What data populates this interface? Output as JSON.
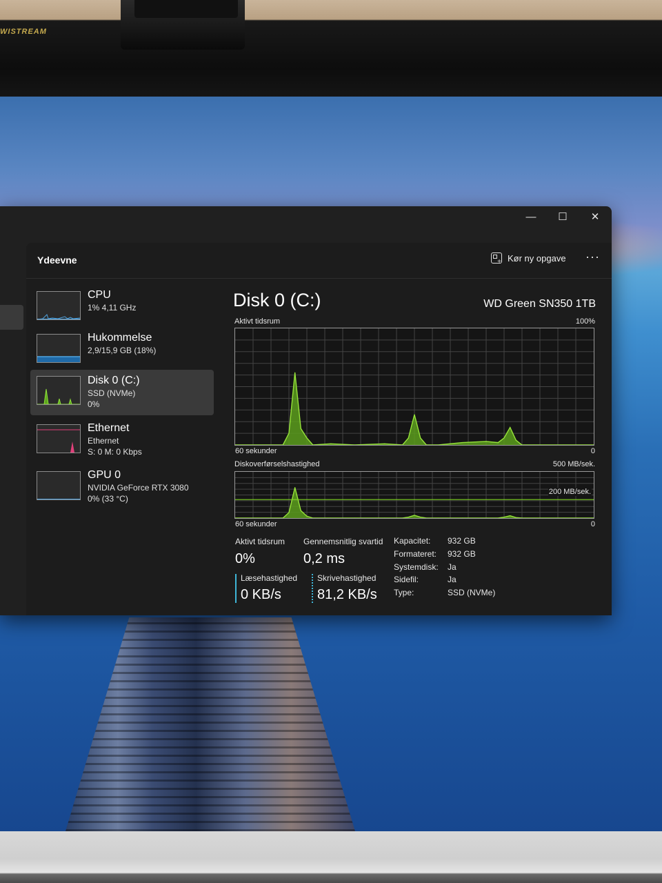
{
  "monitor": {
    "brand": "WISTREAM"
  },
  "window": {
    "controls": {
      "minimize": "—",
      "maximize": "☐",
      "close": "✕"
    },
    "page_title": "Ydeevne",
    "run_task_label": "Kør ny opgave",
    "more_label": "···"
  },
  "sidebar": {
    "items": [
      {
        "name": "CPU",
        "line1": "1% 4,11 GHz",
        "line2": "",
        "line3": "",
        "color": "#4fa3e0"
      },
      {
        "name": "Hukommelse",
        "line1": "2,9/15,9 GB (18%)",
        "line2": "",
        "line3": "",
        "color": "#4fa3e0"
      },
      {
        "name": "Disk 0 (C:)",
        "line1": "SSD (NVMe)",
        "line2": "0%",
        "line3": "",
        "color": "#7fd62a"
      },
      {
        "name": "Ethernet",
        "line1": "Ethernet",
        "line2": "S: 0 M: 0 Kbps",
        "line3": "",
        "color": "#e0407a"
      },
      {
        "name": "GPU 0",
        "line1": "NVIDIA GeForce RTX 3080",
        "line2": "0% (33 °C)",
        "line3": "",
        "color": "#4fa3e0"
      }
    ]
  },
  "detail": {
    "title": "Disk 0 (C:)",
    "model": "WD Green SN350 1TB",
    "graph1": {
      "label": "Aktivt tidsrum",
      "max": "100%",
      "time_label": "60 sekunder",
      "min": "0"
    },
    "graph2": {
      "label": "Diskoverførselshastighed",
      "max": "500 MB/sek.",
      "ref_label": "200 MB/sek.",
      "time_label": "60 sekunder",
      "min": "0"
    },
    "stats": {
      "active_label": "Aktivt tidsrum",
      "active_value": "0%",
      "response_label": "Gennemsnitlig svartid",
      "response_value": "0,2 ms",
      "read_label": "Læsehastighed",
      "read_value": "0 KB/s",
      "write_label": "Skrivehastighed",
      "write_value": "81,2 KB/s"
    },
    "properties": [
      {
        "key": "Kapacitet:",
        "value": "932 GB"
      },
      {
        "key": "Formateret:",
        "value": "932 GB"
      },
      {
        "key": "Systemdisk:",
        "value": "Ja"
      },
      {
        "key": "Sidefil:",
        "value": "Ja"
      },
      {
        "key": "Type:",
        "value": "SSD (NVMe)"
      }
    ]
  },
  "chart_data": [
    {
      "type": "area",
      "title": "Aktivt tidsrum",
      "xlabel": "60 sekunder",
      "ylim": [
        0,
        100
      ],
      "x": [
        60,
        52,
        51,
        50,
        49,
        48,
        47,
        44,
        40,
        35,
        32,
        31,
        30,
        29,
        28,
        26,
        22,
        18,
        16,
        15,
        14,
        13,
        12,
        10,
        5,
        0
      ],
      "series": [
        {
          "values": [
            0,
            0,
            10,
            62,
            14,
            6,
            0,
            1,
            0,
            1,
            0,
            6,
            26,
            6,
            0,
            0,
            2,
            3,
            2,
            6,
            15,
            4,
            0,
            0,
            0,
            0
          ]
        }
      ]
    },
    {
      "type": "area",
      "title": "Diskoverførselshastighed",
      "xlabel": "60 sekunder",
      "ylim": [
        0,
        500
      ],
      "ref_value": 200,
      "x": [
        60,
        52,
        51,
        50,
        49,
        48,
        47,
        44,
        40,
        35,
        32,
        31,
        30,
        29,
        28,
        26,
        22,
        18,
        16,
        15,
        14,
        13,
        12,
        10,
        5,
        0
      ],
      "series": [
        {
          "values": [
            0,
            0,
            60,
            330,
            80,
            20,
            0,
            0,
            0,
            0,
            0,
            10,
            30,
            10,
            0,
            0,
            0,
            0,
            0,
            10,
            25,
            5,
            0,
            0,
            0,
            0
          ]
        }
      ]
    }
  ]
}
